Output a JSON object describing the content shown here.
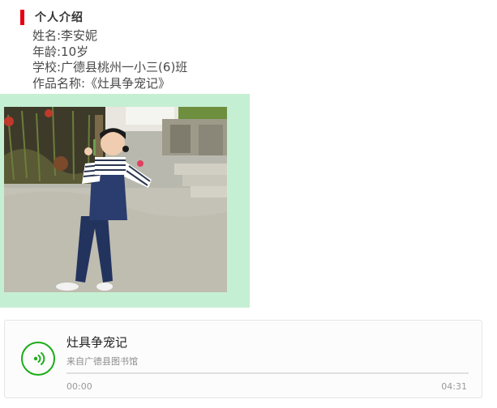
{
  "section": {
    "title": "个人介绍"
  },
  "info": {
    "name": "姓名:李安妮",
    "age": "年龄:10岁",
    "school": "学校:广德县桃州一小三(6)班",
    "work": "作品名称:《灶具争宠记》"
  },
  "photo": {
    "subject": "girl in striped shirt and denim overalls posing outdoors"
  },
  "audio": {
    "title": "灶具争宠记",
    "source": "来自广德县图书馆",
    "current_time": "00:00",
    "total_time": "04:31",
    "progress": 0,
    "icon": "sound-wave-icon"
  },
  "colors": {
    "accent_red": "#e60012",
    "frame_green": "#c5efd3",
    "player_green": "#1aad19"
  }
}
